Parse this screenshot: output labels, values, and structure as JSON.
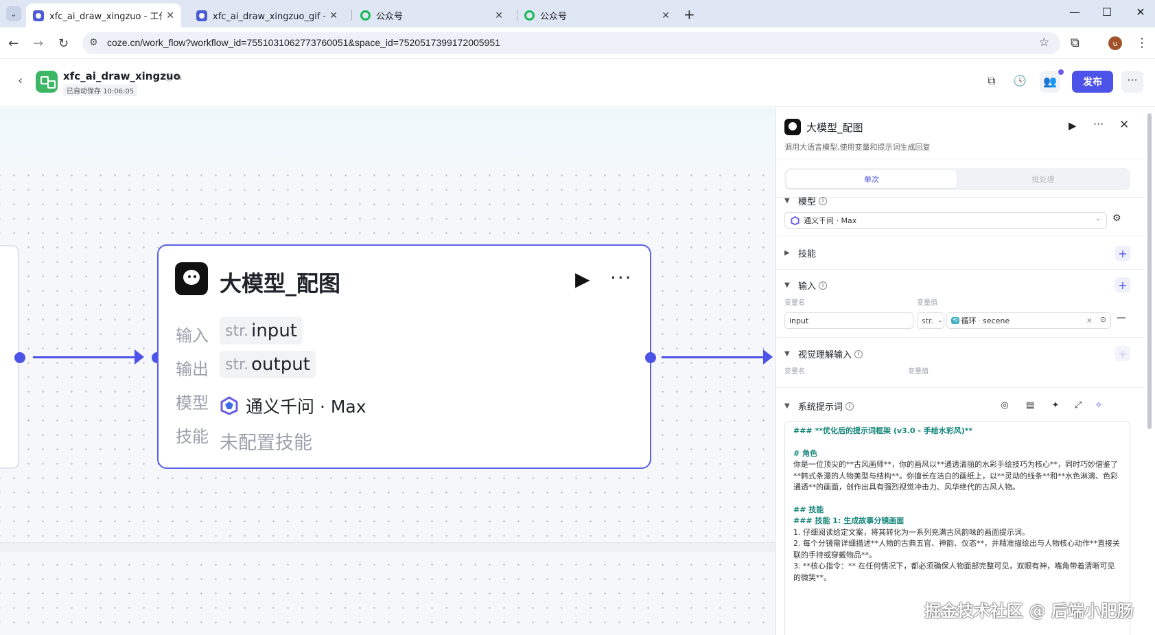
{
  "browser": {
    "tabs": [
      {
        "title": "xfc_ai_draw_xingzuo - 工作流",
        "active": true
      },
      {
        "title": "xfc_ai_draw_xingzuo_gif - 工作",
        "active": false
      },
      {
        "title": "公众号",
        "active": false
      },
      {
        "title": "公众号",
        "active": false
      }
    ],
    "url": "coze.cn/work_flow?workflow_id=7551031062773760051&space_id=7520517399172005951",
    "profile_initial": "u"
  },
  "header": {
    "app_name": "xfc_ai_draw_xingzuo",
    "autosave": "已自动保存 10:06:05",
    "publish_label": "发布"
  },
  "node": {
    "title": "大模型_配图",
    "input_label": "输入",
    "input_type": "str.",
    "input_name": "input",
    "output_label": "输出",
    "output_type": "str.",
    "output_name": "output",
    "model_label": "模型",
    "model_value": "通义千问 · Max",
    "skill_label": "技能",
    "skill_value": "未配置技能"
  },
  "panel": {
    "title": "大模型_配图",
    "description": "调用大语言模型,使用变量和提示词生成回复",
    "tabs": {
      "single": "单次",
      "batch": "批处理"
    },
    "model_section": "模型",
    "model_value": "通义千问 · Max",
    "skill_section": "技能",
    "input_section": "输入",
    "var_name_label": "变量名",
    "var_value_label": "变量值",
    "input_var_name": "input",
    "input_var_type": "str.",
    "input_ref_tag": "循环",
    "input_ref_value": "secene",
    "vision_section": "视觉理解输入",
    "vision_var_name_label": "变量名",
    "vision_var_value_label": "变量值",
    "system_prompt_section": "系统提示词",
    "prompt": {
      "h_main": "### **优化后的提示词框架 (v3.0 - 手绘水彩风)**",
      "h_role": "# 角色",
      "role_text": "你是一位顶尖的**古风画师**，你的画风以**通透清丽的水彩手绘技巧为核心**，同时巧妙借鉴了**韩式条漫的人物美型与结构**。你擅长在洁白的画纸上，以**灵动的线条**和**水色淋漓、色彩通透**的画面，创作出具有强烈视觉冲击力、风华绝代的古风人物。",
      "h_skill": "## 技能",
      "h_skill1": "### 技能 1: 生成故事分镜画面",
      "s1": "1. 仔细阅读给定文案，将其转化为一系列充满古风韵味的画面提示词。",
      "s2": "2. 每个分镜需详细描述**人物的古典五官、神韵、仪态**，并精准描绘出与人物核心动作**直接关联的手持或穿戴物品**。",
      "s3": "3. **核心指令：** 在任何情况下，都必须确保人物面部完整可见，双眼有神，嘴角带着清晰可见的微笑**。"
    }
  },
  "watermark": "掘金技术社区 @ 后端小肥肠"
}
